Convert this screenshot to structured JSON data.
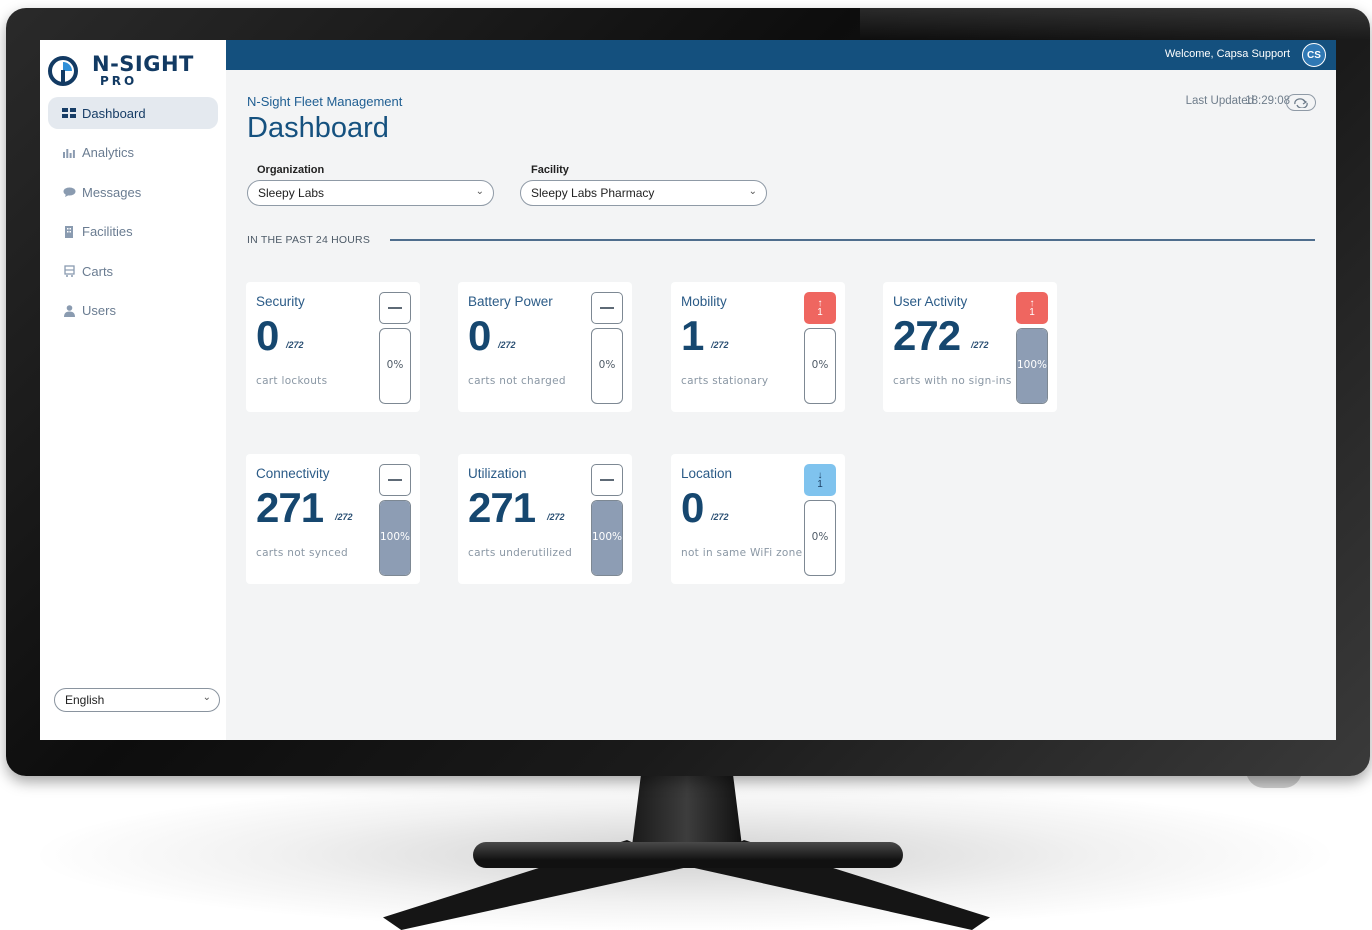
{
  "brand": {
    "name": "N-SIGHT",
    "sub": "PRO"
  },
  "sidebar": {
    "items": [
      {
        "label": "Dashboard",
        "icon": "dashboard-icon",
        "active": true
      },
      {
        "label": "Analytics",
        "icon": "bar-chart-icon"
      },
      {
        "label": "Messages",
        "icon": "message-icon"
      },
      {
        "label": "Facilities",
        "icon": "building-icon"
      },
      {
        "label": "Carts",
        "icon": "cart-icon"
      },
      {
        "label": "Users",
        "icon": "user-icon"
      }
    ],
    "language": "English"
  },
  "header": {
    "welcome": "Welcome, Capsa Support",
    "avatar_initials": "CS",
    "bar_color": "#14507e"
  },
  "main": {
    "breadcrumb": "N-Sight Fleet Management",
    "title": "Dashboard",
    "last_updated_label": "Last Updated",
    "last_updated_time": "18:29:08",
    "organization_label": "Organization",
    "organization_value": "Sleepy Labs",
    "facility_label": "Facility",
    "facility_value": "Sleepy Labs Pharmacy",
    "section_label": "IN THE PAST 24 HOURS"
  },
  "cards": [
    {
      "title": "Security",
      "value": "0",
      "total": "/272",
      "desc": "cart lockouts",
      "trend": "neutral",
      "trend_text": "",
      "percent_label": "0%",
      "fill": 0
    },
    {
      "title": "Battery Power",
      "value": "0",
      "total": "/272",
      "desc": "carts not charged",
      "trend": "neutral",
      "trend_text": "",
      "percent_label": "0%",
      "fill": 0
    },
    {
      "title": "Mobility",
      "value": "1",
      "total": "/272",
      "desc": "carts stationary",
      "trend": "up",
      "trend_text": "↑\n1",
      "percent_label": "0%",
      "fill": 0
    },
    {
      "title": "User Activity",
      "value": "272",
      "total": "/272",
      "desc": "carts with no sign-ins",
      "trend": "up",
      "trend_text": "↑\n1",
      "percent_label": "100%",
      "fill": 100
    },
    {
      "title": "Connectivity",
      "value": "271",
      "total": "/272",
      "desc": "carts not synced",
      "trend": "neutral",
      "trend_text": "",
      "percent_label": "100%",
      "fill": 100
    },
    {
      "title": "Utilization",
      "value": "271",
      "total": "/272",
      "desc": "carts underutilized",
      "trend": "neutral",
      "trend_text": "",
      "percent_label": "100%",
      "fill": 100
    },
    {
      "title": "Location",
      "value": "0",
      "total": "/272",
      "desc": "not in same WiFi zone",
      "trend": "down",
      "trend_text": "↓\n1",
      "percent_label": "0%",
      "fill": 0
    }
  ],
  "colors": {
    "accent": "#15517f",
    "up": "#ef6660",
    "down": "#7fc3ee",
    "gauge_fill": "#8d9db4"
  }
}
